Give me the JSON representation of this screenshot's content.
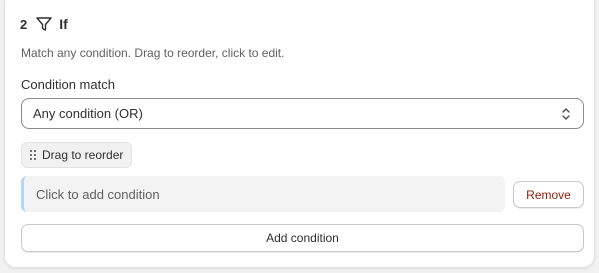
{
  "step": {
    "number": "2",
    "title": "If",
    "icon": "filter-icon"
  },
  "description": "Match any condition. Drag to reorder, click to edit.",
  "condition_match": {
    "label": "Condition match",
    "selected": "Any condition (OR)"
  },
  "drag_chip": {
    "icon": "drag-handle-icon",
    "label": "Drag to reorder"
  },
  "condition": {
    "placeholder": "Click to add condition",
    "remove_label": "Remove"
  },
  "add_condition_label": "Add condition",
  "colors": {
    "accent_border": "#b4d5f7",
    "remove_text": "#8e1f0b",
    "text": "#303030",
    "muted_text": "#616161"
  }
}
